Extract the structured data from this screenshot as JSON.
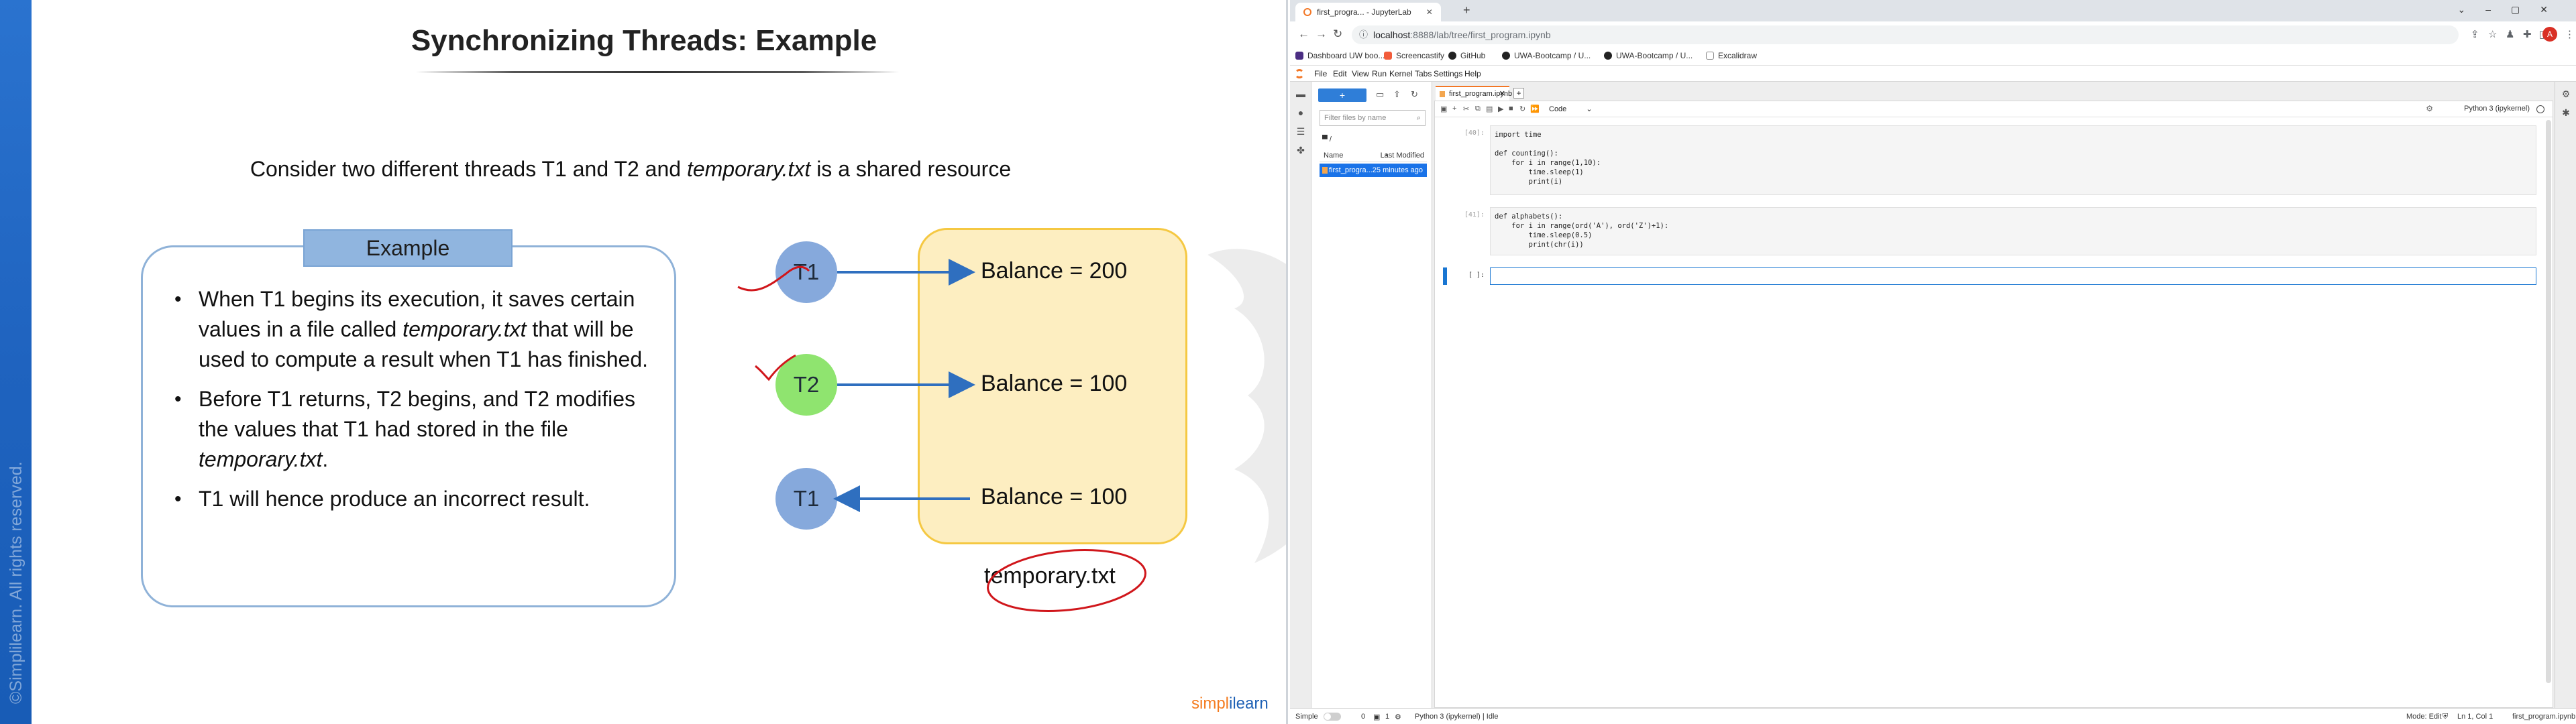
{
  "slide": {
    "copyright": "©Simplilearn. All rights reserved.",
    "title": "Synchronizing Threads: Example",
    "intro_pre": "Consider two different threads T1 and T2 and ",
    "intro_file": "temporary.txt",
    "intro_post": " is a shared resource",
    "example_label": "Example",
    "bullet1_a": "When T1 begins its execution, it saves certain values in a file called ",
    "bullet1_file": "temporary.txt",
    "bullet1_b": " that will be used to compute a result when T1 has finished.",
    "bullet2_a": "Before T1 returns, T2 begins, and T2 modifies the values that T1 had stored in the file ",
    "bullet2_file": "temporary.txt",
    "bullet2_b": ".",
    "bullet3": "T1 will hence produce an incorrect result.",
    "thread_top": "T1",
    "thread_mid": "T2",
    "thread_bottom": "T1",
    "balance_top": "Balance = 200",
    "balance_mid": "Balance = 100",
    "balance_bottom": "Balance = 100",
    "resource_label": "temporary.txt",
    "logo_a": "simpl",
    "logo_b": "ilearn",
    "colors": {
      "sidebar": "#1f63bf",
      "resource_fill": "#fdeec1",
      "resource_border": "#f5c842",
      "thread_blue": "#86a9dc",
      "thread_green": "#8fe46f",
      "arrow": "#2f6fbf",
      "annotation": "#d0161b"
    }
  },
  "browser": {
    "tabs": [
      {
        "label": "first_progra... - JupyterLab",
        "active": true
      }
    ],
    "url_host": "localhost",
    "url_path": ":8888/lab/tree/first_program.ipynb",
    "avatar_letter": "A",
    "bookmarks": [
      "Dashboard UW boo...",
      "Screencastify",
      "GitHub",
      "UWA-Bootcamp / U...",
      "UWA-Bootcamp / U...",
      "Excalidraw"
    ]
  },
  "jupyter": {
    "menu": [
      "File",
      "Edit",
      "View",
      "Run",
      "Kernel",
      "Tabs",
      "Settings",
      "Help"
    ],
    "filter_placeholder": "Filter files by name",
    "crumb": "/",
    "col_name": "Name",
    "col_modified": "Last Modified",
    "file_name": "first_progra...",
    "file_modified": "25 minutes ago",
    "doc_tab": "first_program.ipynb",
    "cell_type": "Code",
    "kernel": "Python 3 (ipykernel)",
    "cells": [
      {
        "prompt": "[40]:",
        "lines": [
          "import time",
          "",
          "def counting():",
          "    for i in range(1,10):",
          "        time.sleep(1)",
          "        print(i)"
        ]
      },
      {
        "prompt": "[41]:",
        "lines": [
          "def alphabets():",
          "    for i in range(ord('A'), ord('Z')+1):",
          "        time.sleep(0.5)",
          "        print(chr(i))"
        ]
      },
      {
        "prompt": "[ ]:",
        "lines": [
          ""
        ]
      }
    ],
    "status": {
      "mode_simple": "Simple",
      "count_a": "0",
      "count_b": "1",
      "kernel_state": "Python 3 (ipykernel) | Idle",
      "mode": "Mode: Edit",
      "position": "Ln 1, Col 1",
      "file": "first_program.ipynb"
    }
  }
}
